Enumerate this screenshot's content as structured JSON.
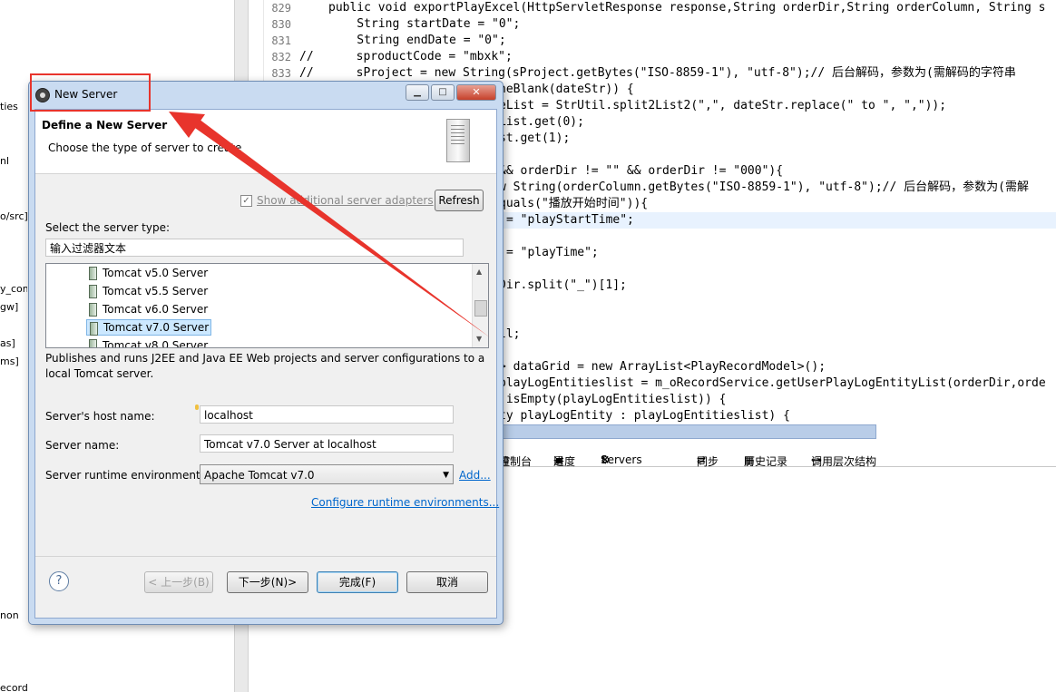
{
  "ide": {
    "left_fragments": [
      "ties",
      "nl",
      "o/src]",
      "y_com",
      "gw]",
      "as]",
      "ms]",
      "non",
      "ecord"
    ],
    "line_numbers": [
      "829",
      "830",
      "831",
      "832",
      "833"
    ],
    "code": {
      "l829": "public void exportPlayExcel(HttpServletResponse response,String orderDir,String orderColumn, String s",
      "l830": "    String startDate = \"0\";",
      "l831": "    String endDate = \"0\";",
      "l832_comment": "//      sproductCode = \"mbxk\";",
      "l833_comment": "//      sProject = new String(sProject.getBytes(\"ISO-8859-1\"), \"utf-8\");// 后台解码，参数为(需解码的字符串",
      "l834": "neBlank(dateStr)) {",
      "l835": "eList = StrUtil.split2List2(\",\", dateStr.replace(\" to \", \",\"));",
      "l836": "List.get(0);",
      "l837": "st.get(1);",
      "l839": "&& orderDir != \"\" && orderDir != \"000\"){",
      "l840": "w String(orderColumn.getBytes(\"ISO-8859-1\"), \"utf-8\");// 后台解码，参数为(需解",
      "l841": "quals(\"播放开始时间\")){",
      "l842": "= \"playStartTime\";",
      "l844": "= \"playTime\";",
      "l846": "Dir.split(\"_\")[1];",
      "l849": "ll;",
      "l851": "> dataGrid = new ArrayList<PlayRecordModel>();",
      "l852": "playLogEntitieslist = m_oRecordService.getUserPlayLogEntityList(orderDir,orde",
      "l853": ".isEmpty(playLogEntitieslist)) {",
      "l854": "ty playLogEntity : playLogEntitieslist) {"
    },
    "views_tabs": [
      "控制台",
      "进度",
      "Servers",
      "同步",
      "历史记录",
      "调用层次结构"
    ]
  },
  "dialog": {
    "title": "New Server",
    "banner_title": "Define a New Server",
    "banner_desc": "Choose the type of server to create",
    "show_adapters_label": "Show additional server adapters",
    "show_adapters_checked": true,
    "refresh_label": "Refresh",
    "select_type_label": "Select the server type:",
    "filter_value": "输入过滤器文本",
    "server_types": [
      "Tomcat v5.0 Server",
      "Tomcat v5.5 Server",
      "Tomcat v6.0 Server",
      "Tomcat v7.0 Server",
      "Tomcat v8.0 Server"
    ],
    "selected_type": "Tomcat v7.0 Server",
    "type_description": "Publishes and runs J2EE and Java EE Web projects and server configurations to a local Tomcat server.",
    "host_label": "Server's host name:",
    "host_value": "localhost",
    "name_label": "Server name:",
    "name_value": "Tomcat v7.0 Server at localhost",
    "runtime_label": "Server runtime environment:",
    "runtime_value": "Apache Tomcat v7.0",
    "add_link": "Add...",
    "configure_link": "Configure runtime environments...",
    "buttons": {
      "back": "< 上一步(B)",
      "next": "下一步(N)>",
      "finish": "完成(F)",
      "cancel": "取消"
    }
  },
  "colors": {
    "annotation": "#e8342c",
    "selection": "#cce8ff"
  }
}
